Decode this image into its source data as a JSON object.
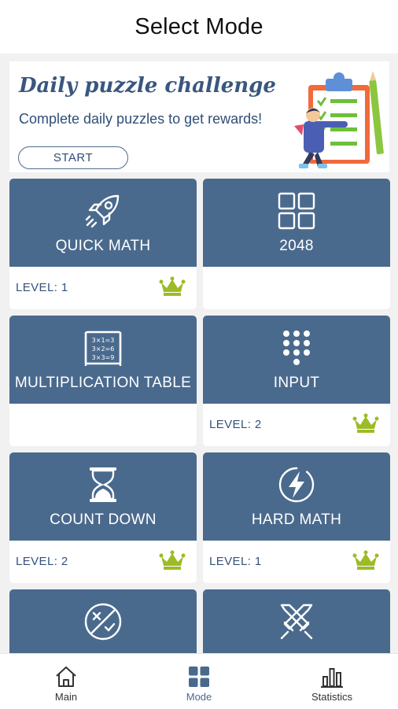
{
  "header": {
    "title": "Select Mode"
  },
  "banner": {
    "title": "Daily puzzle challenge",
    "subtitle": "Complete daily puzzles to get rewards!",
    "start_label": "START"
  },
  "modes": [
    {
      "label": "QUICK MATH",
      "icon": "rocket-icon",
      "level": "LEVEL: 1",
      "crown": true
    },
    {
      "label": "2048",
      "icon": "grid-icon",
      "level": "",
      "crown": false
    },
    {
      "label": "MULTIPLICATION TABLE",
      "icon": "multiplication-table-icon",
      "level": "",
      "crown": false
    },
    {
      "label": "INPUT",
      "icon": "keypad-icon",
      "level": "LEVEL: 2",
      "crown": true
    },
    {
      "label": "COUNT DOWN",
      "icon": "hourglass-icon",
      "level": "LEVEL: 2",
      "crown": true
    },
    {
      "label": "HARD MATH",
      "icon": "lightning-icon",
      "level": "LEVEL: 1",
      "crown": true
    },
    {
      "label": "",
      "icon": "true-false-icon",
      "level": "",
      "crown": false
    },
    {
      "label": "",
      "icon": "crossed-swords-icon",
      "level": "",
      "crown": false
    }
  ],
  "nav": {
    "items": [
      {
        "label": "Main",
        "icon": "home-icon"
      },
      {
        "label": "Mode",
        "icon": "grid-icon"
      },
      {
        "label": "Statistics",
        "icon": "bar-chart-icon"
      }
    ],
    "active": "Mode"
  },
  "colors": {
    "card_top": "#4a6a8d",
    "crown": "#9dbb26",
    "background": "#f1f1f1"
  }
}
